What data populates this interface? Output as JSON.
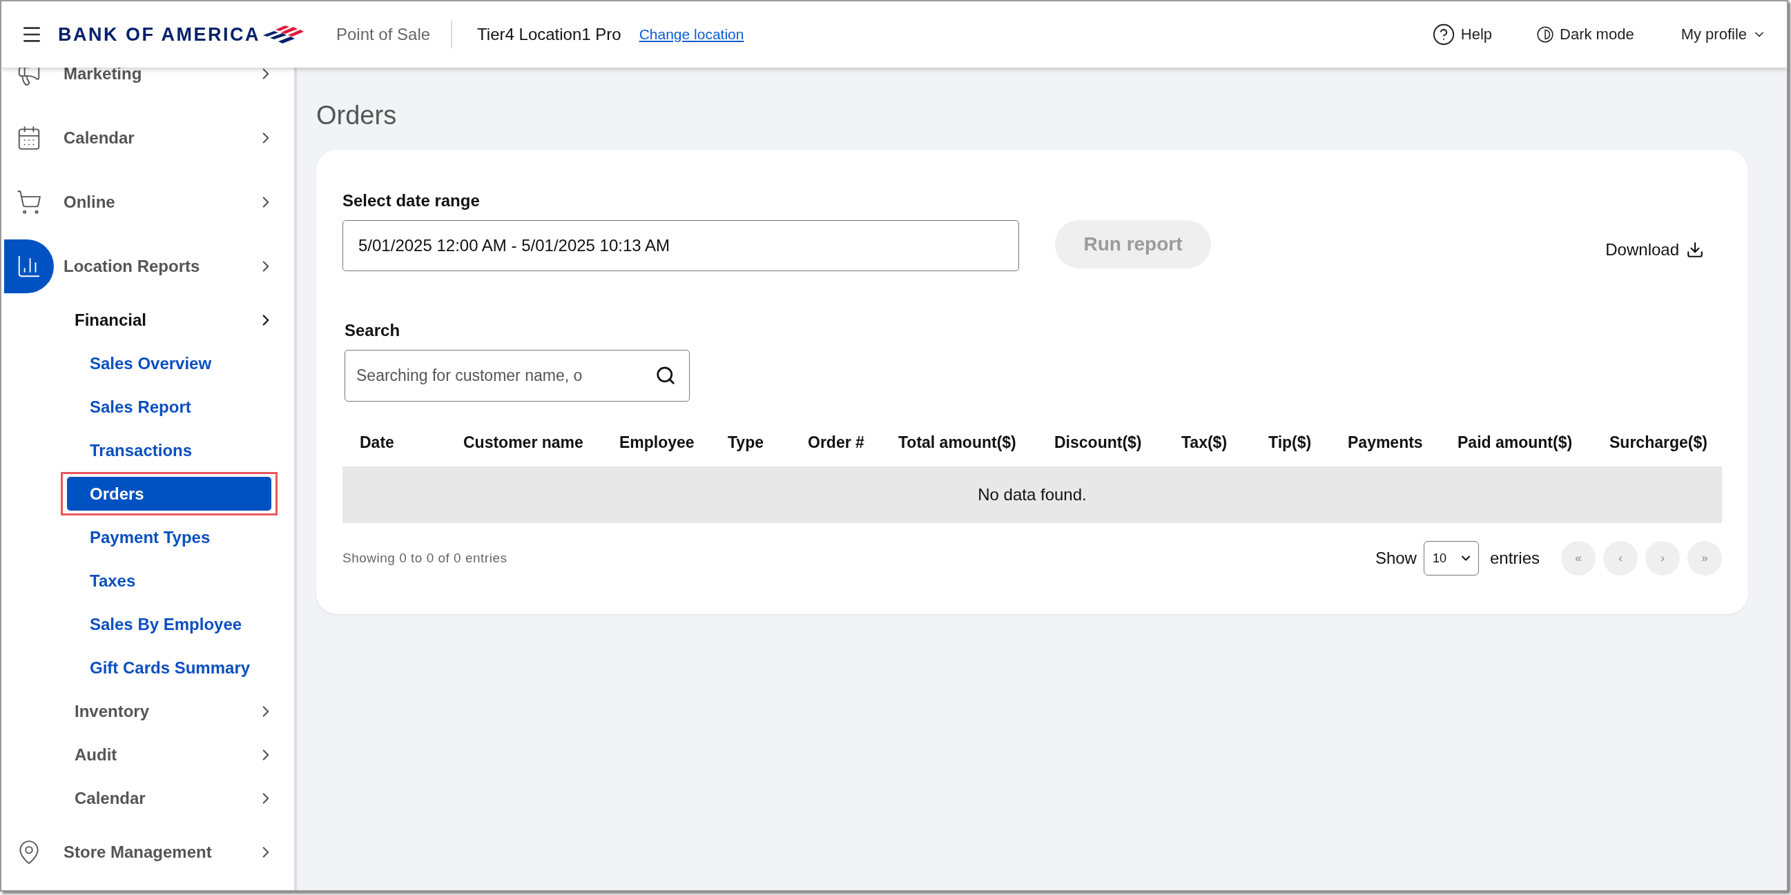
{
  "header": {
    "brand": "BANK OF AMERICA",
    "app_name": "Point of Sale",
    "location": "Tier4 Location1 Pro",
    "change_location": "Change location",
    "help": "Help",
    "dark_mode": "Dark mode",
    "profile": "My profile"
  },
  "sidebar": {
    "items": [
      {
        "label": "Marketing",
        "selected": false
      },
      {
        "label": "Calendar",
        "selected": false
      },
      {
        "label": "Online",
        "selected": false
      },
      {
        "label": "Location Reports",
        "selected": true,
        "children": [
          {
            "label": "Financial",
            "children": [
              {
                "label": "Sales Overview",
                "selected": false,
                "annotated": false
              },
              {
                "label": "Sales Report",
                "selected": false,
                "annotated": false
              },
              {
                "label": "Transactions",
                "selected": false,
                "annotated": false
              },
              {
                "label": "Orders",
                "selected": true,
                "annotated": true
              },
              {
                "label": "Payment Types",
                "selected": false,
                "annotated": false
              },
              {
                "label": "Taxes",
                "selected": false,
                "annotated": false
              },
              {
                "label": "Sales By Employee",
                "selected": false,
                "annotated": false
              },
              {
                "label": "Gift Cards Summary",
                "selected": false,
                "annotated": false
              }
            ]
          },
          {
            "label": "Inventory"
          },
          {
            "label": "Audit"
          },
          {
            "label": "Calendar"
          }
        ]
      },
      {
        "label": "Store Management",
        "selected": false
      }
    ]
  },
  "main": {
    "title": "Orders",
    "date_range": {
      "label": "Select date range",
      "value": "5/01/2025 12:00 AM - 5/01/2025 10:13 AM"
    },
    "run_report": {
      "label": "Run report",
      "disabled": true
    },
    "download": "Download",
    "search": {
      "label": "Search",
      "placeholder": "Searching for customer name, o"
    },
    "table": {
      "columns": [
        "Date",
        "Customer name",
        "Employee",
        "Type",
        "Order #",
        "Total amount($)",
        "Discount($)",
        "Tax($)",
        "Tip($)",
        "Payments",
        "Paid amount($)",
        "Surcharge($)"
      ],
      "empty_message": "No data found."
    },
    "footer": {
      "info": "Showing 0 to 0 of 0 entries",
      "show": "Show",
      "page_size": "10",
      "entries": "entries",
      "pager": [
        "«",
        "‹",
        "›",
        "»"
      ]
    }
  }
}
